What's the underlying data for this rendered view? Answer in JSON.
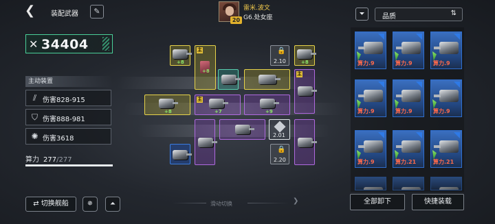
{
  "header": {
    "title": "装配武器",
    "back_icon": "back-chevron-icon",
    "edit_icon": "pencil-icon"
  },
  "player": {
    "name": "雷米.波文",
    "description": "G6.处女座",
    "level": "20"
  },
  "power": {
    "value": "34404",
    "icon": "crossed-swords-icon"
  },
  "skills": {
    "section_label": "主动装置",
    "items": [
      {
        "label": "伤害828-915",
        "icon": "slash-icon"
      },
      {
        "label": "伤害888-981",
        "icon": "shield-slash-icon"
      },
      {
        "label": "伤害3618",
        "icon": "gear-burst-icon"
      }
    ]
  },
  "capacity": {
    "label": "算力",
    "current": "277",
    "max": "/277",
    "fill_fraction": 1.0
  },
  "grid": {
    "main_tag": "主",
    "bonus_plus8": "+8",
    "bonus_plus9": "+9",
    "bonus_plus7": "+7",
    "lock_cost_1": "2.10",
    "lock_cost_2": "2.01",
    "lock_cost_3": "2.20"
  },
  "footer": {
    "switch_ship": "切换舰船",
    "swipe_hint": "滑动切换"
  },
  "inventory": {
    "filter_icon": "filter-icon",
    "sort_label": "品质",
    "sort_icon": "sort-toggle-icon",
    "items": [
      {
        "value": "算力.9"
      },
      {
        "value": "算力.9"
      },
      {
        "value": "算力.9"
      },
      {
        "value": "算力.9"
      },
      {
        "value": "算力.9"
      },
      {
        "value": "算力.9"
      },
      {
        "value": "算力.9"
      },
      {
        "value": "算力.21"
      },
      {
        "value": "算力.21"
      }
    ],
    "unequip_all": "全部卸下",
    "quick_equip": "快捷装载"
  },
  "colors": {
    "accent_green": "#4ad19a",
    "slot_yellow": "#e8d44a",
    "slot_purple": "#b06ae0",
    "item_blue": "#2f6fd0",
    "value_red": "#ff6a4a"
  }
}
